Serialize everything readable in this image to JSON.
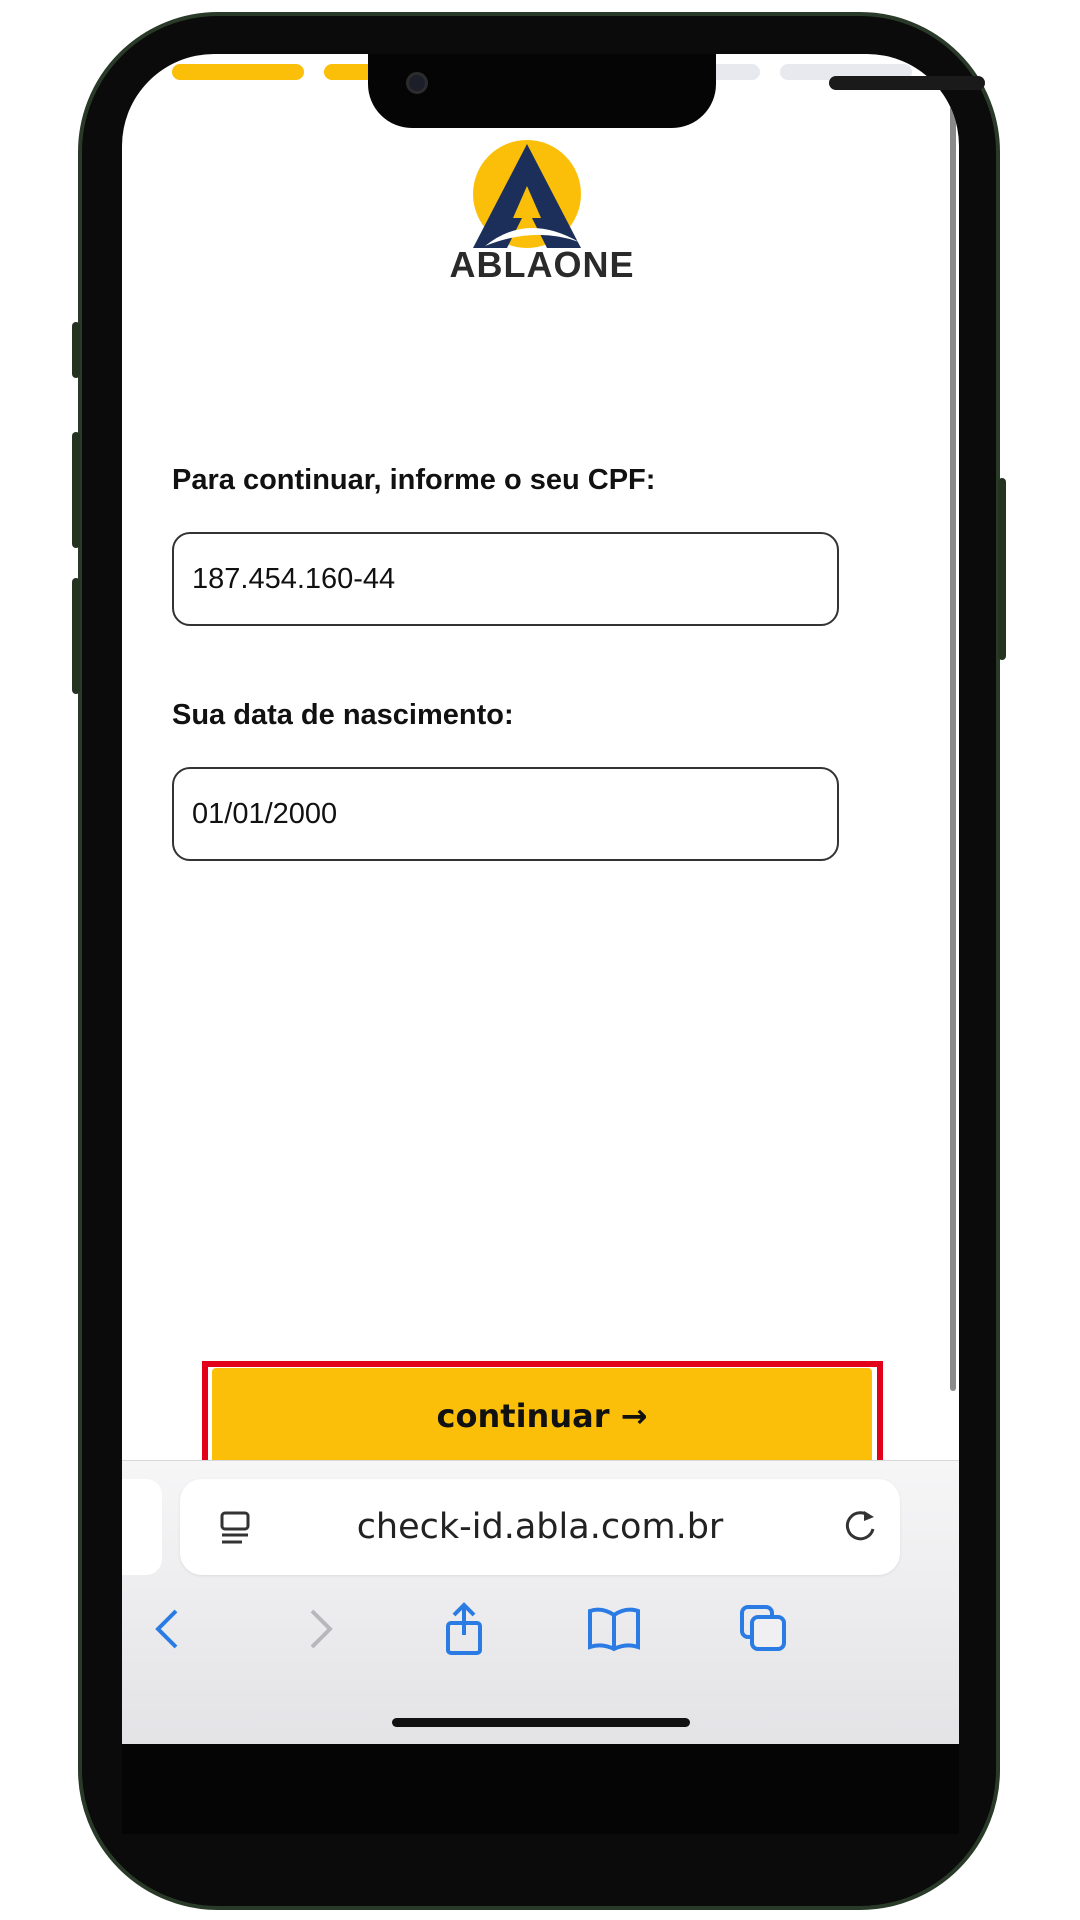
{
  "brand": {
    "name": "ABLAONE",
    "primary": "#fbbf0a",
    "navy": "#1b2f5a"
  },
  "progress": {
    "steps": [
      {
        "state": "done"
      },
      {
        "state": "done"
      },
      {
        "state": "todo"
      },
      {
        "state": "todo"
      },
      {
        "state": "todo"
      }
    ],
    "active_color": "#fbbf0a",
    "inactive_color": "#e8e9ee"
  },
  "form": {
    "cpf_label": "Para continuar, informe o seu CPF:",
    "cpf_value": "187.454.160-44",
    "birth_label": "Sua data de nascimento:",
    "birth_value": "01/01/2000"
  },
  "cta": {
    "label": "continuar  →",
    "highlight_color": "#e2001a"
  },
  "browser": {
    "url": "check-id.abla.com.br",
    "accent": "#2a7be4",
    "icons": [
      "reader-icon",
      "reload-icon",
      "back-icon",
      "forward-icon",
      "share-icon",
      "bookmarks-icon",
      "tabs-icon"
    ]
  }
}
